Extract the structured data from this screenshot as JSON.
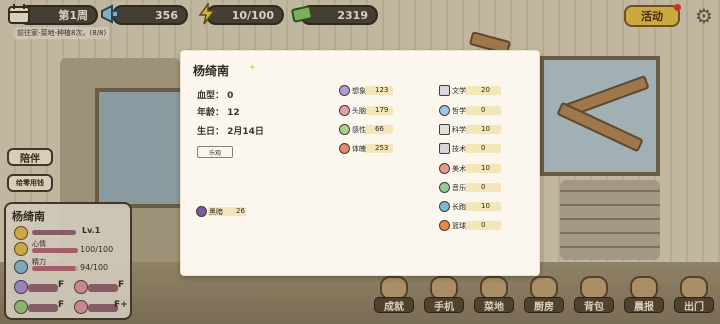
{
  "topbar": {
    "week": "第1周",
    "horn_value": "356",
    "energy": "10/100",
    "money": "2319",
    "event_label": "活动",
    "task_text": "前往家-菜地-种植8次。(8/8)"
  },
  "side": {
    "companion_label": "陪伴",
    "pocket_money_label": "给零用钱"
  },
  "status": {
    "name": "杨绮南",
    "level": "Lv.1",
    "mood_label": "心情",
    "mood_value": "100/100",
    "mood_fraction": 1.0,
    "stamina_label": "精力",
    "stamina_value": "94/100",
    "stamina_fraction": 0.94,
    "rank_1": "F",
    "rank_2": "F",
    "rank_3": "F",
    "rank_4": "F+"
  },
  "modal": {
    "name": "杨绮南",
    "blood_type": "血型： 0",
    "age": "年龄： 12",
    "birthday": "生日： 2月14日",
    "tag": "乐观",
    "attributes": [
      {
        "label": "想象",
        "value": "123"
      },
      {
        "label": "头脑",
        "value": "179"
      },
      {
        "label": "感性",
        "value": "66"
      },
      {
        "label": "体魄",
        "value": "253"
      }
    ],
    "skills": [
      {
        "label": "文学",
        "value": "20"
      },
      {
        "label": "哲学",
        "value": "0"
      },
      {
        "label": "科学",
        "value": "10"
      },
      {
        "label": "技术",
        "value": "0"
      },
      {
        "label": "美术",
        "value": "10"
      },
      {
        "label": "音乐",
        "value": "0"
      },
      {
        "label": "长跑",
        "value": "10"
      },
      {
        "label": "篮球",
        "value": "0"
      }
    ],
    "dark": {
      "label": "黑暗",
      "value": "26"
    }
  },
  "bottom_nav": [
    {
      "label": "成就",
      "icon": "trophy-icon"
    },
    {
      "label": "手机",
      "icon": "phone-icon"
    },
    {
      "label": "菜地",
      "icon": "sprout-icon"
    },
    {
      "label": "厨房",
      "icon": "pot-icon"
    },
    {
      "label": "背包",
      "icon": "backpack-icon"
    },
    {
      "label": "晨报",
      "icon": "newspaper-icon"
    },
    {
      "label": "出门",
      "icon": "map-pin-icon"
    }
  ],
  "colors": {
    "accent": "#f1c64a",
    "dark_bar": "#4c4538",
    "modal_bg": "#fbf7ee",
    "bar_highlight": "#f4e6b8"
  }
}
